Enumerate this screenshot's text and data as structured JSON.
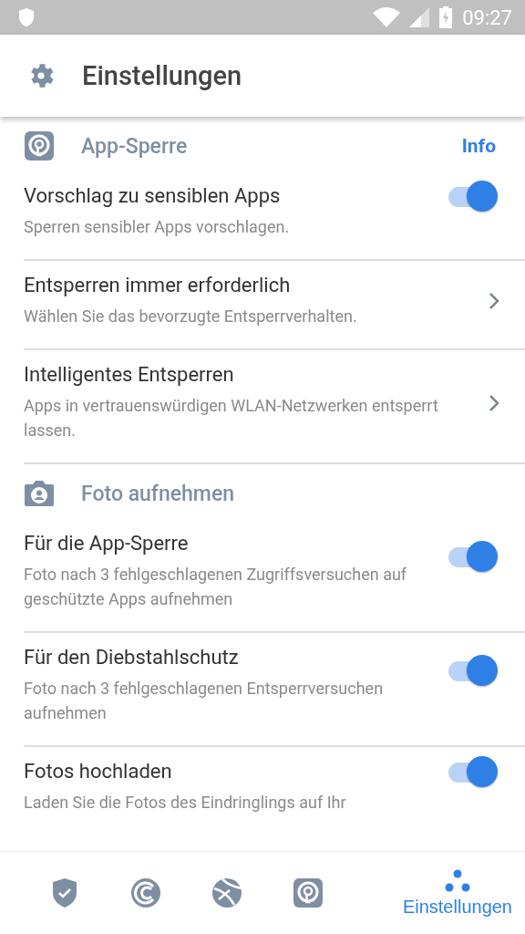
{
  "status_bar": {
    "time": "09:27"
  },
  "header": {
    "title": "Einstellungen"
  },
  "sections": [
    {
      "kind": "lock",
      "title": "App-Sperre",
      "action": "Info",
      "items": [
        {
          "kind": "toggle",
          "title": "Vorschlag zu sensiblen Apps",
          "description": "Sperren sensibler Apps vorschlagen.",
          "on": true
        },
        {
          "kind": "link",
          "title": "Entsperren immer erforderlich",
          "description": "Wählen Sie das bevorzugte Entsperrverhalten."
        },
        {
          "kind": "link",
          "title": "Intelligentes Entsperren",
          "description": "Apps in vertrauenswürdigen WLAN-Netzwerken entsperrt lassen."
        }
      ]
    },
    {
      "kind": "camera",
      "title": "Foto aufnehmen",
      "items": [
        {
          "kind": "toggle",
          "title": "Für die App-Sperre",
          "description": "Foto nach 3 fehlgeschlagenen Zugriffsversuchen auf geschützte Apps aufnehmen",
          "on": true
        },
        {
          "kind": "toggle",
          "title": "Für den Diebstahlschutz",
          "description": "Foto nach 3 fehlgeschlagenen Entsperrversuchen aufnehmen",
          "on": true
        },
        {
          "kind": "toggle",
          "title": "Fotos hochladen",
          "description": "Laden Sie die Fotos des Eindringlings auf Ihr",
          "on": true
        }
      ]
    }
  ],
  "nav": [
    {
      "kind": "shield",
      "selected": false
    },
    {
      "kind": "cleaner",
      "selected": false
    },
    {
      "kind": "ball",
      "selected": false
    },
    {
      "kind": "lock",
      "selected": false
    },
    {
      "kind": "dots",
      "label": "Einstellungen",
      "selected": true
    }
  ]
}
